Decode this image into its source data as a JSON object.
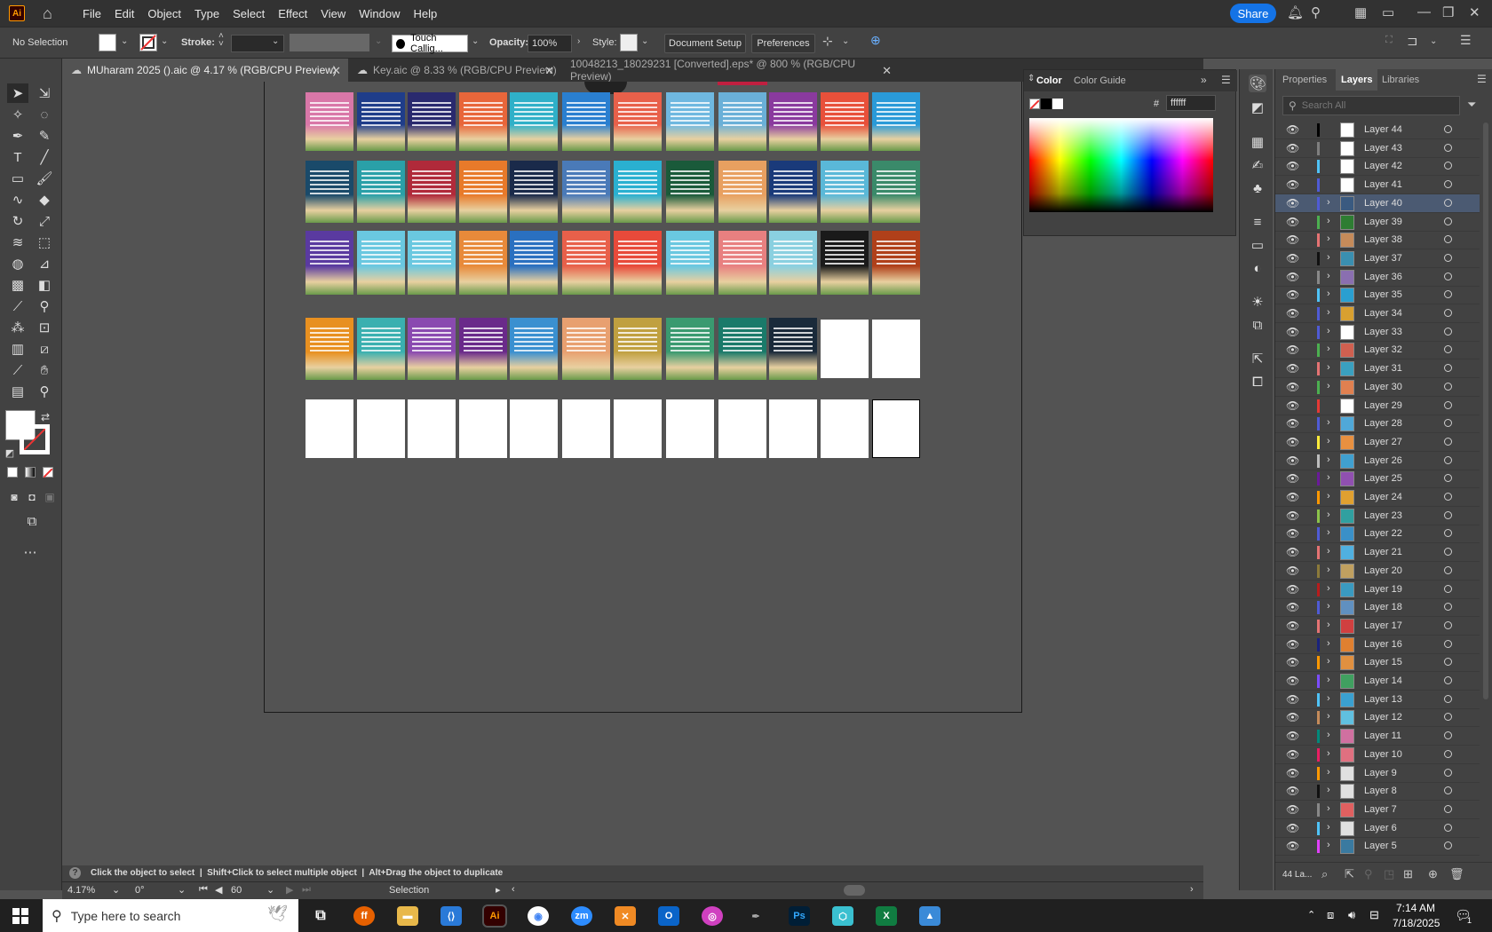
{
  "menubar": {
    "app_icon": "Ai",
    "items": [
      "File",
      "Edit",
      "Object",
      "Type",
      "Select",
      "Effect",
      "View",
      "Window",
      "Help"
    ],
    "share_label": "Share"
  },
  "control": {
    "selection_label": "No Selection",
    "stroke_label": "Stroke:",
    "brush_name": "Touch Callig...",
    "opacity_label": "Opacity:",
    "opacity_value": "100%",
    "style_label": "Style:",
    "document_setup": "Document Setup",
    "preferences": "Preferences"
  },
  "tabs": [
    {
      "label": "MUharam 2025 ().aic @ 4.17 % (RGB/CPU Preview)"
    },
    {
      "label": "Key.aic @ 8.33 % (RGB/CPU Preview)"
    },
    {
      "label": "10048213_18029231 [Converted].eps* @ 800 % (RGB/CPU Preview)"
    }
  ],
  "color_panel": {
    "tab_color": "Color",
    "tab_guide": "Color Guide",
    "hash": "#",
    "hex_value": "ffffff"
  },
  "layers_panel": {
    "tabs": [
      "Properties",
      "Layers",
      "Libraries"
    ],
    "search_placeholder": "Search All",
    "layers": [
      {
        "name": "Layer 44",
        "color": "#000000",
        "thumb": "#ffffff",
        "expand": false
      },
      {
        "name": "Layer 43",
        "color": "#7f7f7f",
        "thumb": "#ffffff",
        "expand": false
      },
      {
        "name": "Layer 42",
        "color": "#4fc3f7",
        "thumb": "#ffffff",
        "expand": false
      },
      {
        "name": "Layer 41",
        "color": "#4f5bd5",
        "thumb": "#ffffff",
        "expand": false
      },
      {
        "name": "Layer 40",
        "color": "#4f5bd5",
        "thumb": "#3a5a80",
        "expand": true
      },
      {
        "name": "Layer 39",
        "color": "#4caf50",
        "thumb": "#2e7d32",
        "expand": true
      },
      {
        "name": "Layer 38",
        "color": "#e57373",
        "thumb": "#c58b5a",
        "expand": true
      },
      {
        "name": "Layer 37",
        "color": "#111111",
        "thumb": "#3a8fb0",
        "expand": true
      },
      {
        "name": "Layer 36",
        "color": "#888888",
        "thumb": "#8a6fb0",
        "expand": true
      },
      {
        "name": "Layer 35",
        "color": "#4fc3f7",
        "thumb": "#2a9fd0",
        "expand": true
      },
      {
        "name": "Layer 34",
        "color": "#4f5bd5",
        "thumb": "#d8a030",
        "expand": true
      },
      {
        "name": "Layer 33",
        "color": "#4f5bd5",
        "thumb": "#ffffff",
        "expand": true
      },
      {
        "name": "Layer 32",
        "color": "#4caf50",
        "thumb": "#d06050",
        "expand": true
      },
      {
        "name": "Layer 31",
        "color": "#e57373",
        "thumb": "#3aa0c0",
        "expand": true
      },
      {
        "name": "Layer 30",
        "color": "#4caf50",
        "thumb": "#e08050",
        "expand": true
      },
      {
        "name": "Layer 29",
        "color": "#e53935",
        "thumb": "#ffffff",
        "expand": false
      },
      {
        "name": "Layer 28",
        "color": "#4f5bd5",
        "thumb": "#50a8d8",
        "expand": true
      },
      {
        "name": "Layer 27",
        "color": "#ffeb3b",
        "thumb": "#e89040",
        "expand": true
      },
      {
        "name": "Layer 26",
        "color": "#bdbdbd",
        "thumb": "#40a0d0",
        "expand": true
      },
      {
        "name": "Layer 25",
        "color": "#6a1b9a",
        "thumb": "#9050b0",
        "expand": true
      },
      {
        "name": "Layer 24",
        "color": "#ff9800",
        "thumb": "#e0a030",
        "expand": true
      },
      {
        "name": "Layer 23",
        "color": "#8bc34a",
        "thumb": "#30a0a0",
        "expand": true
      },
      {
        "name": "Layer 22",
        "color": "#4f5bd5",
        "thumb": "#3a90c8",
        "expand": true
      },
      {
        "name": "Layer 21",
        "color": "#e57373",
        "thumb": "#50b0e0",
        "expand": true
      },
      {
        "name": "Layer 20",
        "color": "#8b7a3a",
        "thumb": "#c0a060",
        "expand": true
      },
      {
        "name": "Layer 19",
        "color": "#b71c1c",
        "thumb": "#3a9ac0",
        "expand": true
      },
      {
        "name": "Layer 18",
        "color": "#4f5bd5",
        "thumb": "#6090c0",
        "expand": true
      },
      {
        "name": "Layer 17",
        "color": "#e57373",
        "thumb": "#d04040",
        "expand": true
      },
      {
        "name": "Layer 16",
        "color": "#1a237e",
        "thumb": "#e08030",
        "expand": true
      },
      {
        "name": "Layer 15",
        "color": "#ff9800",
        "thumb": "#e09040",
        "expand": true
      },
      {
        "name": "Layer 14",
        "color": "#7c4dff",
        "thumb": "#40a060",
        "expand": true
      },
      {
        "name": "Layer 13",
        "color": "#4fc3f7",
        "thumb": "#3aa0d0",
        "expand": true
      },
      {
        "name": "Layer 12",
        "color": "#c58b5a",
        "thumb": "#60c0e0",
        "expand": true
      },
      {
        "name": "Layer 11",
        "color": "#00897b",
        "thumb": "#d070a0",
        "expand": true
      },
      {
        "name": "Layer 10",
        "color": "#e91e63",
        "thumb": "#e07080",
        "expand": true
      },
      {
        "name": "Layer 9",
        "color": "#ff9800",
        "thumb": "#e0e0e0",
        "expand": true
      },
      {
        "name": "Layer 8",
        "color": "#111111",
        "thumb": "#e0e0e0",
        "expand": true
      },
      {
        "name": "Layer 7",
        "color": "#888888",
        "thumb": "#e06060",
        "expand": true
      },
      {
        "name": "Layer 6",
        "color": "#4fc3f7",
        "thumb": "#e0e0e0",
        "expand": true
      },
      {
        "name": "Layer 5",
        "color": "#e040fb",
        "thumb": "#3a7aa0",
        "expand": true
      }
    ],
    "footer_count": "44 La..."
  },
  "artboard_grid": {
    "row1": [
      "#d977a8",
      "#1f3d8a",
      "#2a2a6e",
      "#e8663a",
      "#2fb0c8",
      "#2a7fd0",
      "#e8604a",
      "#6fb8e0",
      "#6ab0d8",
      "#8a3a9e",
      "#e8503a",
      "#2a9ad8"
    ],
    "row2": [
      "#1a4a6a",
      "#2aa0a8",
      "#b02a3a",
      "#e87a2a",
      "#1a2a4a",
      "#4a7ab8",
      "#2ab0d0",
      "#1a5a3a",
      "#e8a060",
      "#1a3a7a",
      "#5ab8d8",
      "#3a8a6a"
    ],
    "row3": [
      "#5a3aa0",
      "#6ac8e0",
      "#6ac8e0",
      "#e88a3a",
      "#2a70c0",
      "#e8604a",
      "#e84a3a",
      "#6ac8e0",
      "#e88080",
      "#8ad0e0",
      "#1a1a1a",
      "#b0401a"
    ],
    "row4": [
      "#e89020",
      "#3ab0b0",
      "#8a4ab0",
      "#6a2a8a",
      "#3a90d0",
      "#e8a070",
      "#c0a040",
      "#3a9a70",
      "#1a7a6a",
      "#1a2a3a",
      "#ffffff",
      "#ffffff"
    ]
  },
  "status": {
    "hint": "Click the object to select  |  Shift+Click to select multiple object  |  Alt+Drag the object to duplicate",
    "zoom": "4.17%",
    "rotation": "0°",
    "artboard_num": "60",
    "tool": "Selection"
  },
  "taskbar": {
    "search_placeholder": "Type here to search",
    "time": "7:14 AM",
    "date": "7/18/2025",
    "notif_count": "1"
  }
}
